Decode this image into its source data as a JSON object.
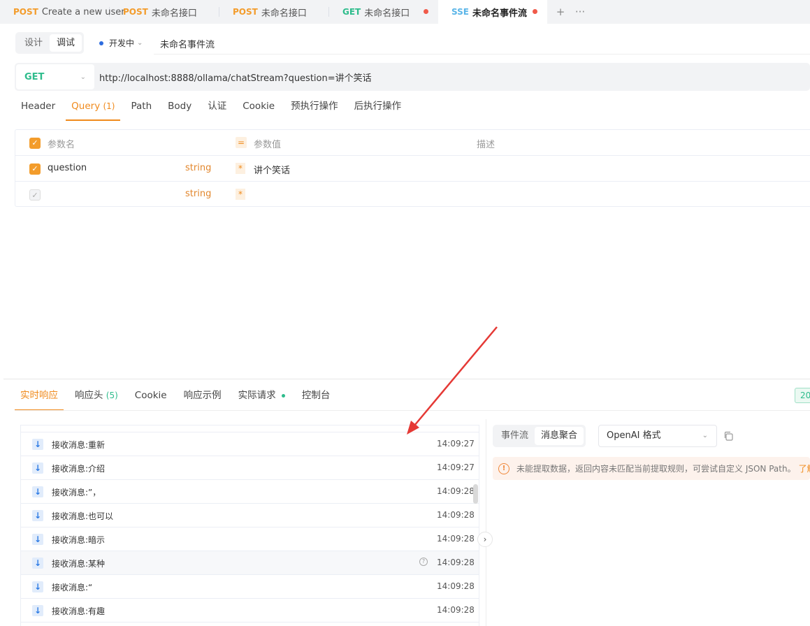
{
  "tabs": [
    {
      "method": "POST",
      "title": "Create a new user",
      "method_color": "#f39c2b",
      "active": false,
      "dot": false
    },
    {
      "method": "POST",
      "title": "未命名接口",
      "method_color": "#f39c2b",
      "active": false,
      "dot": false
    },
    {
      "method": "POST",
      "title": "未命名接口",
      "method_color": "#f39c2b",
      "active": false,
      "dot": false
    },
    {
      "method": "GET",
      "title": "未命名接口",
      "method_color": "#2ebc8c",
      "active": false,
      "dot": true
    },
    {
      "method": "SSE",
      "title": "未命名事件流",
      "method_color": "#5ab5e8",
      "active": true,
      "dot": true
    }
  ],
  "tabbar": {
    "plus": "+",
    "more": "···"
  },
  "mode": {
    "design": "设计",
    "debug": "调试"
  },
  "env": {
    "label": "开发中"
  },
  "request_name": "未命名事件流",
  "url_bar": {
    "method": "GET",
    "url": "http://localhost:8888/ollama/chatStream?question=讲个笑话"
  },
  "param_tabs": {
    "header": "Header",
    "query": "Query",
    "query_count": "(1)",
    "path": "Path",
    "body": "Body",
    "auth": "认证",
    "cookie": "Cookie",
    "pre": "预执行操作",
    "post": "后执行操作"
  },
  "params_table": {
    "head": {
      "name": "参数名",
      "eq": "=",
      "value": "参数值",
      "desc": "描述"
    },
    "rows": [
      {
        "name": "question",
        "type": "string",
        "value": "讲个笑话"
      },
      {
        "name": "",
        "type": "string",
        "value": ""
      }
    ]
  },
  "response_tabs": {
    "realtime": "实时响应",
    "headers": "响应头",
    "headers_count": "(5)",
    "cookie": "Cookie",
    "example": "响应示例",
    "actual": "实际请求",
    "console": "控制台",
    "status": "20"
  },
  "events": [
    {
      "text": "接收消息:重新",
      "time": "14:09:27",
      "highlight": false
    },
    {
      "text": "接收消息:介绍",
      "time": "14:09:27",
      "highlight": false
    },
    {
      "text": "接收消息:”，",
      "time": "14:09:28",
      "highlight": false
    },
    {
      "text": "接收消息:也可以",
      "time": "14:09:28",
      "highlight": false
    },
    {
      "text": "接收消息:暗示",
      "time": "14:09:28",
      "highlight": false
    },
    {
      "text": "接收消息:某种",
      "time": "14:09:28",
      "highlight": true
    },
    {
      "text": "接收消息:“",
      "time": "14:09:28",
      "highlight": false
    },
    {
      "text": "接收消息:有趣",
      "time": "14:09:28",
      "highlight": false
    }
  ],
  "right_panel": {
    "stream": "事件流",
    "merge": "消息聚合",
    "format": "OpenAI 格式",
    "warning": "未能提取数据，返回内容未匹配当前提取规则，可尝试自定义 JSON Path。",
    "warning_link": "了解"
  },
  "colors": {
    "accent": "#f08a1c",
    "get": "#2ebc8c",
    "sse": "#5ab5e8",
    "arrow": "#e53935"
  }
}
